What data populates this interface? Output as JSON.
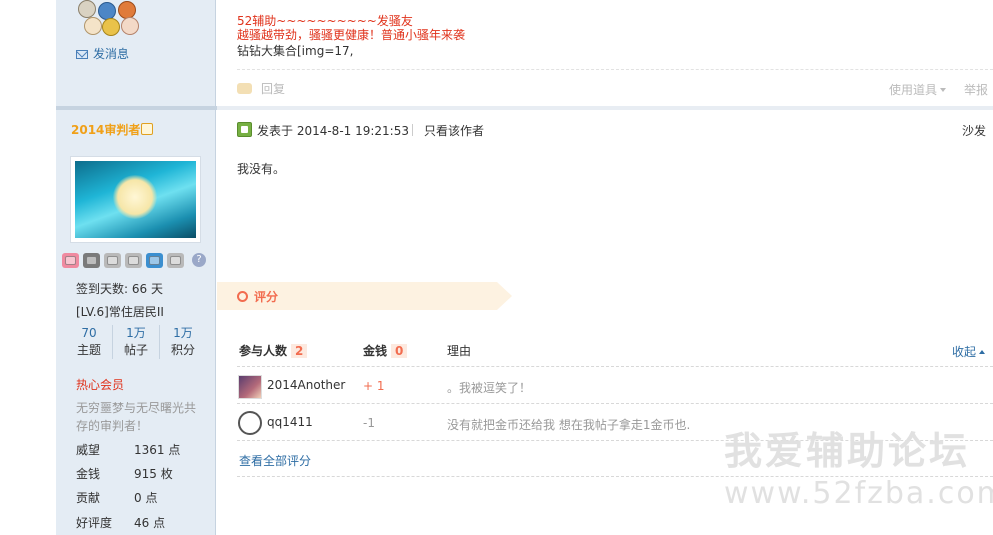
{
  "previous_post": {
    "lines": [
      {
        "text": "52辅助~~~~~~~~~~发骚友",
        "style": "red"
      },
      {
        "text": "越骚越带劲，骚骚更健康！普通小骚年来袭",
        "style": "red"
      },
      {
        "text": "钻钻大集合[img=17,",
        "style": "black"
      }
    ],
    "send_message_label": "发消息",
    "reply_label": "回复",
    "tools_label": "使用道具",
    "report_label": "举报"
  },
  "author": {
    "username": "2014审判者",
    "signin_days": "签到天数: 66 天",
    "level": "[LV.6]常住居民II",
    "stats": [
      {
        "value": "70",
        "label": "主题"
      },
      {
        "value": "1万",
        "label": "帖子"
      },
      {
        "value": "1万",
        "label": "积分"
      }
    ],
    "member_group": "热心会员",
    "description": "无穷噩梦与无尽曙光共存的审判者！",
    "fields": [
      {
        "key": "威望",
        "value": "1361 点"
      },
      {
        "key": "金钱",
        "value": "915 枚"
      },
      {
        "key": "贡献",
        "value": "0 点"
      },
      {
        "key": "好评度",
        "value": "46 点"
      }
    ]
  },
  "post": {
    "posted_at": "发表于 2014-8-1 19:21:53",
    "author_only_label": "只看该作者",
    "floor_label": "沙发",
    "content": "我没有。"
  },
  "rating": {
    "title": "评分",
    "participants_label": "参与人数",
    "participants_count": "2",
    "money_label": "金钱",
    "money_total": "0",
    "reason_label": "理由",
    "collapse_label": "收起",
    "rows": [
      {
        "name": "2014Another",
        "score": "+ 1",
        "reason": "。我被逗笑了！"
      },
      {
        "name": "qq1411",
        "score": "-1",
        "reason": "没有就把金币还给我 想在我帖子拿走1金币也."
      }
    ],
    "view_all_label": "查看全部评分"
  },
  "watermark": {
    "cn": "我爱辅助论坛",
    "url": "www.52fzba.com"
  },
  "colors": {
    "accent_orange": "#f26c4f",
    "link_blue": "#2e6da4",
    "sidebar_bg": "#e4ecf4",
    "username_gold": "#f0a018"
  }
}
